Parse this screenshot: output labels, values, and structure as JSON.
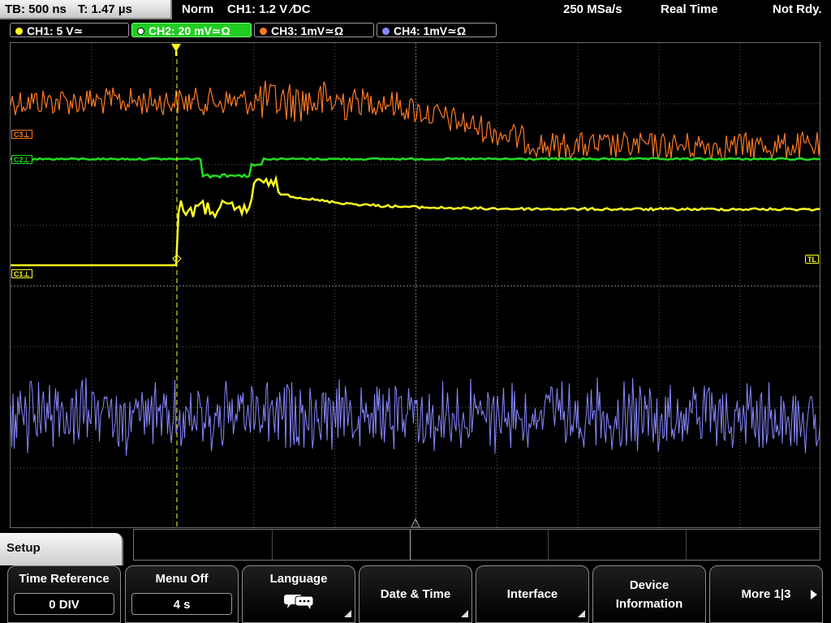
{
  "topbar": {
    "timebase": "TB: 500 ns",
    "trigger_pos": "T: 1.47 µs",
    "acq_mode": "Norm",
    "trigger_setting": "CH1: 1.2 V ∕DC",
    "sample_rate": "250 MSa/s",
    "realtime": "Real Time",
    "status": "Not Rdy."
  },
  "channels": [
    {
      "label": "CH1: 5 V≃",
      "color": "#ffff22",
      "active": false
    },
    {
      "label": "CH2: 20 mV≃Ω",
      "color": "#22dd22",
      "active": true
    },
    {
      "label": "CH3: 1mV≃Ω",
      "color": "#ff7a22",
      "active": false
    },
    {
      "label": "CH4: 1mV≃Ω",
      "color": "#8888ff",
      "active": false
    }
  ],
  "markers": {
    "c3": "C3",
    "c2": "C2",
    "c1": "C1",
    "trigger_level": "TL"
  },
  "menu": {
    "title": "Setup",
    "softkeys": [
      {
        "label": "Time Reference",
        "value": "0 DIV"
      },
      {
        "label": "Menu Off",
        "value": "4 s"
      },
      {
        "label": "Language",
        "icon": "speech-bubbles-icon"
      },
      {
        "label": "Date & Time"
      },
      {
        "label": "Interface"
      },
      {
        "label_line1": "Device",
        "label_line2": "Information"
      },
      {
        "label": "More 1|3"
      }
    ]
  },
  "colors": {
    "ch1": "#ffff22",
    "ch2": "#22dd22",
    "ch3": "#ff7a22",
    "ch4": "#8888ff",
    "grid": "#5a5a5a"
  }
}
